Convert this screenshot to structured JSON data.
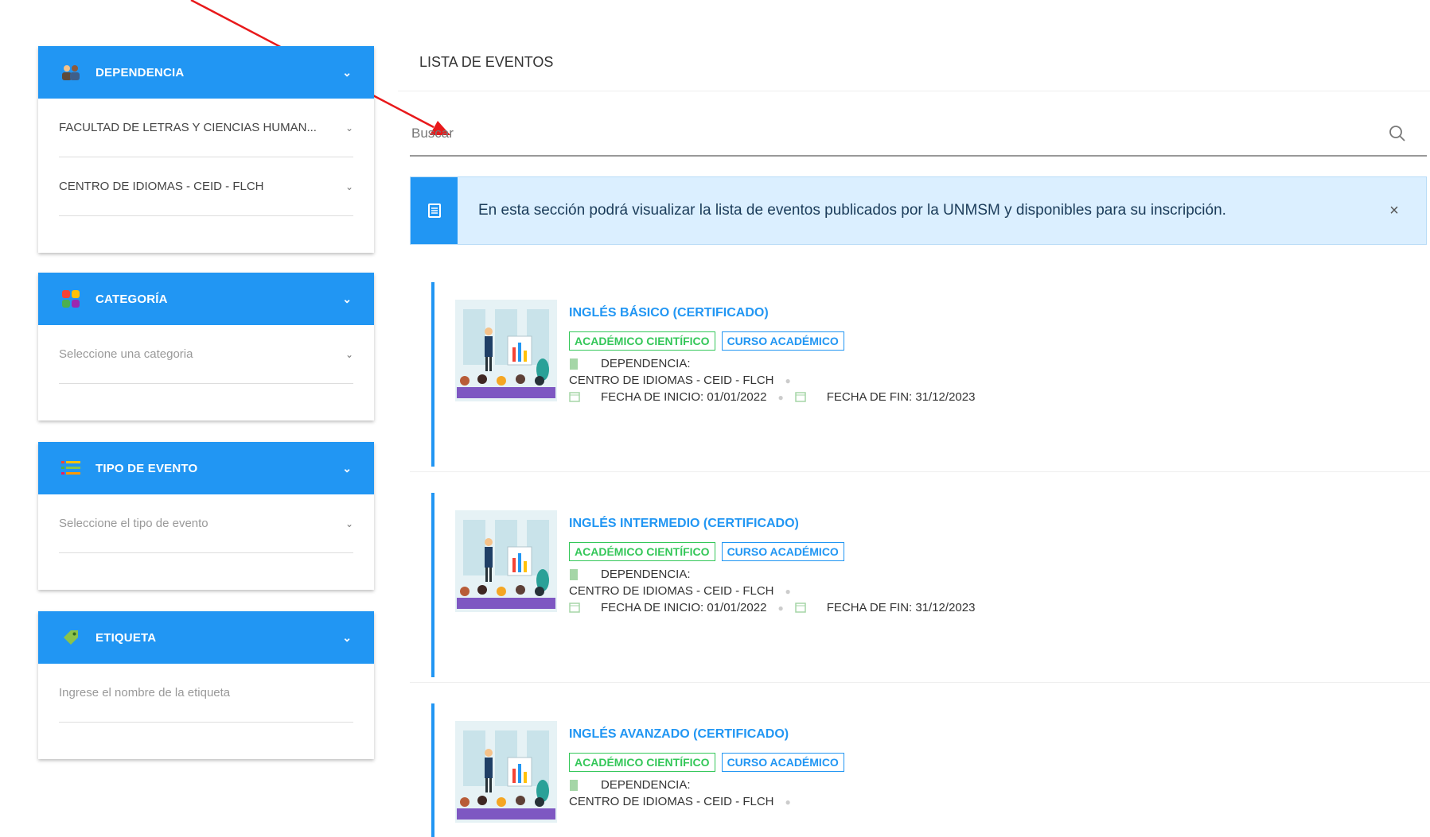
{
  "sidebar": {
    "dependencia": {
      "title": "DEPENDENCIA",
      "facultad": "FACULTAD DE LETRAS Y CIENCIAS HUMAN...",
      "centro": "CENTRO DE IDIOMAS - CEID - FLCH"
    },
    "categoria": {
      "title": "CATEGORÍA",
      "placeholder": "Seleccione una categoria"
    },
    "tipo_evento": {
      "title": "TIPO DE EVENTO",
      "placeholder": "Seleccione el tipo de evento"
    },
    "etiqueta": {
      "title": "ETIQUETA",
      "placeholder": "Ingrese el nombre de la etiqueta"
    }
  },
  "main": {
    "title": "LISTA DE EVENTOS",
    "search_placeholder": "Buscar",
    "alert_text": "En esta sección podrá visualizar la lista de eventos publicados por la UNMSM y disponibles para su inscripción.",
    "alert_close": "×"
  },
  "events": [
    {
      "title": "INGLÉS BÁSICO (CERTIFICADO)",
      "tag1": "ACADÉMICO CIENTÍFICO",
      "tag2": "CURSO ACADÉMICO",
      "dependencia_label": "DEPENDENCIA:",
      "dependencia": "CENTRO DE IDIOMAS - CEID - FLCH",
      "inicio": "FECHA DE INICIO: 01/01/2022",
      "fin": "FECHA DE FIN: 31/12/2023"
    },
    {
      "title": "INGLÉS INTERMEDIO (CERTIFICADO)",
      "tag1": "ACADÉMICO CIENTÍFICO",
      "tag2": "CURSO ACADÉMICO",
      "dependencia_label": "DEPENDENCIA:",
      "dependencia": "CENTRO DE IDIOMAS - CEID - FLCH",
      "inicio": "FECHA DE INICIO: 01/01/2022",
      "fin": "FECHA DE FIN: 31/12/2023"
    },
    {
      "title": "INGLÉS AVANZADO (CERTIFICADO)",
      "tag1": "ACADÉMICO CIENTÍFICO",
      "tag2": "CURSO ACADÉMICO",
      "dependencia_label": "DEPENDENCIA:",
      "dependencia": "CENTRO DE IDIOMAS - CEID - FLCH"
    }
  ],
  "colors": {
    "primary": "#2196f3",
    "tag_green": "#34c759",
    "alert_bg": "#dbefff",
    "arrow": "#e8191b"
  },
  "icons": {
    "dependencia": "people-icon",
    "categoria": "grid-icon",
    "tipo_evento": "list-icon",
    "etiqueta": "tag-icon",
    "search": "search-icon",
    "alert": "document-icon"
  }
}
